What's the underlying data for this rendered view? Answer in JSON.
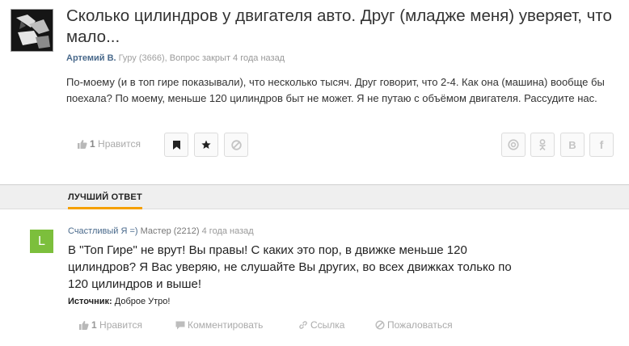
{
  "question": {
    "title": "Сколько цилиндров у двигателя авто. Друг (младже меня) уверяет, что мало...",
    "author": "Артемий В.",
    "rank": "Гуру",
    "score": "(3666),",
    "status": "Вопрос закрыт 4 года назад",
    "body": "По-моему (и в топ гире показывали), что несколько тысяч. Друг говорит, что 2-4. Как она (машина) вообще бы поехала? По моему, меньше 120 цилиндров быт не может. Я не путаю с объёмом двигателя. Рассудите нас.",
    "likes": "1",
    "like_label": "Нравится"
  },
  "best_answer": {
    "tab_label": "ЛУЧШИЙ ОТВЕТ",
    "avatar_letter": "L",
    "author": "Счастливый Я =)",
    "rank": "Мастер",
    "score": "(2212)",
    "time": "4 года назад",
    "body": "В \"Топ Гире\" не врут! Вы правы! С каких это пор, в движке меньше 120 цилиндров? Я Вас уверяю, не слушайте Вы других, во всех движках только по 120 цилиндров и выше!",
    "source_label": "Источник:",
    "source_value": "Доброе Утро!",
    "likes": "1",
    "like_label": "Нравится",
    "comment_label": "Комментировать",
    "link_label": "Ссылка",
    "report_label": "Пожаловаться"
  },
  "colors": {
    "accent": "#f5a000",
    "author_link": "#4a6a8c",
    "avatar_green": "#7cbf3c"
  },
  "icons": [
    "thumbs-up-icon",
    "bookmark-icon",
    "star-icon",
    "block-icon",
    "at-icon",
    "odnoklassniki-icon",
    "vk-icon",
    "facebook-icon",
    "comment-icon",
    "link-icon",
    "report-icon"
  ]
}
